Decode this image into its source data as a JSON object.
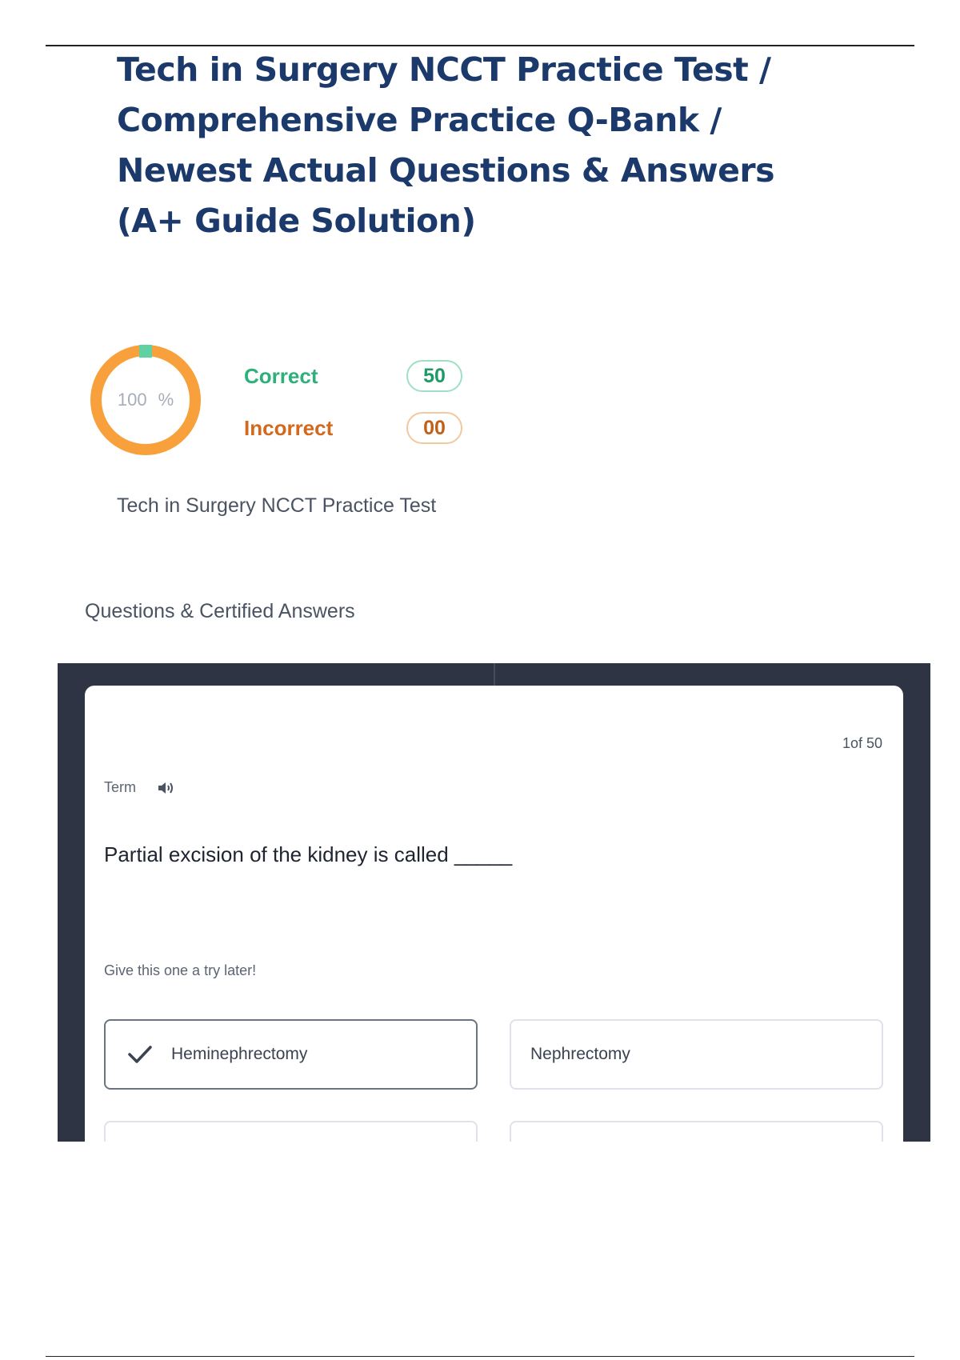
{
  "document": {
    "title": "Tech in Surgery NCCT Practice Test / Comprehensive Practice Q-Bank / Newest Actual Questions & Answers (A+ Guide Solution)",
    "subtitle": "Tech in Surgery NCCT Practice Test",
    "section_heading": "Questions & Certified Answers"
  },
  "score": {
    "percent_value": "100",
    "percent_sign": "%",
    "correct_label": "Correct",
    "correct_count": "50",
    "incorrect_label": "Incorrect",
    "incorrect_count": "00",
    "colors": {
      "ring": "#f7a03c",
      "marker": "#5fd1a3",
      "correct": "#2db07a",
      "incorrect": "#d2691e"
    }
  },
  "card": {
    "counter": "1of 50",
    "term_label": "Term",
    "term_icon": "speaker-icon",
    "question": "Partial excision of the kidney is called _____",
    "hint": "Give this one a try later!",
    "options": [
      {
        "label": "Heminephrectomy",
        "selected": true,
        "icon": "check-icon"
      },
      {
        "label": "Nephrectomy",
        "selected": false
      },
      {
        "label": "",
        "selected": false
      },
      {
        "label": "",
        "selected": false
      }
    ]
  }
}
